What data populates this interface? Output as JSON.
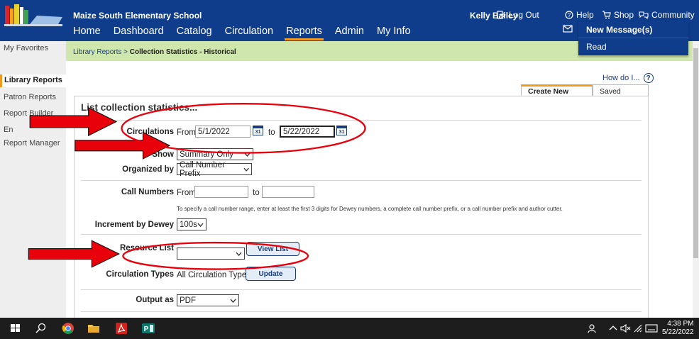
{
  "header": {
    "school_name": "Maize South Elementary School",
    "user_name": "Kelly Bailey",
    "log_out": "Log Out",
    "help": "Help",
    "shop": "Shop",
    "community": "Community",
    "nav": [
      "Home",
      "Dashboard",
      "Catalog",
      "Circulation",
      "Reports",
      "Admin",
      "My Info"
    ],
    "active_nav": "Reports"
  },
  "messages_menu": {
    "new_messages": "New Message(s)",
    "read": "Read"
  },
  "breadcrumb": {
    "parent": "Library Reports",
    "separator": " > ",
    "current": "Collection Statistics - Historical"
  },
  "sidebar": {
    "items": [
      "My Favorites",
      "Library Reports",
      "Patron Reports",
      "Report Builder",
      "En",
      "Report Manager"
    ],
    "active": "Library Reports"
  },
  "help_link": "How do I...",
  "tabs": [
    "Create New Report",
    "Saved Reports"
  ],
  "form": {
    "title": "List collection statistics...",
    "circulations": {
      "label": "Circulations",
      "from_word": "From",
      "from_value": "5/1/2022",
      "to_word": "to",
      "to_value": "5/22/2022",
      "cal_day": "31"
    },
    "show": {
      "label": "Show",
      "value": "Summary Only"
    },
    "organized_by": {
      "label": "Organized by",
      "value": "Call Number Prefix"
    },
    "call_numbers": {
      "label": "Call Numbers",
      "from_word": "From",
      "to_word": "to",
      "from_value": "",
      "to_value": ""
    },
    "call_number_note": "To specify a call number range, enter at least the first 3 digits for Dewey numbers, a complete call number prefix, or a call number prefix and author cutter.",
    "increment": {
      "label": "Increment by Dewey",
      "value": "100s"
    },
    "resource_list": {
      "label": "Resource List",
      "value": "",
      "button": "View List"
    },
    "circulation_types": {
      "label": "Circulation Types",
      "value": "All Circulation Types",
      "button": "Update"
    },
    "output_as": {
      "label": "Output as",
      "value": "PDF"
    }
  },
  "taskbar": {
    "time": "4:38 PM",
    "date": "5/22/2022"
  },
  "colors": {
    "header_blue": "#0f3d8c",
    "accent_orange": "#f39a1e",
    "breadcrumb_green": "#cfe6ad",
    "annotation_red": "#e8000b"
  }
}
